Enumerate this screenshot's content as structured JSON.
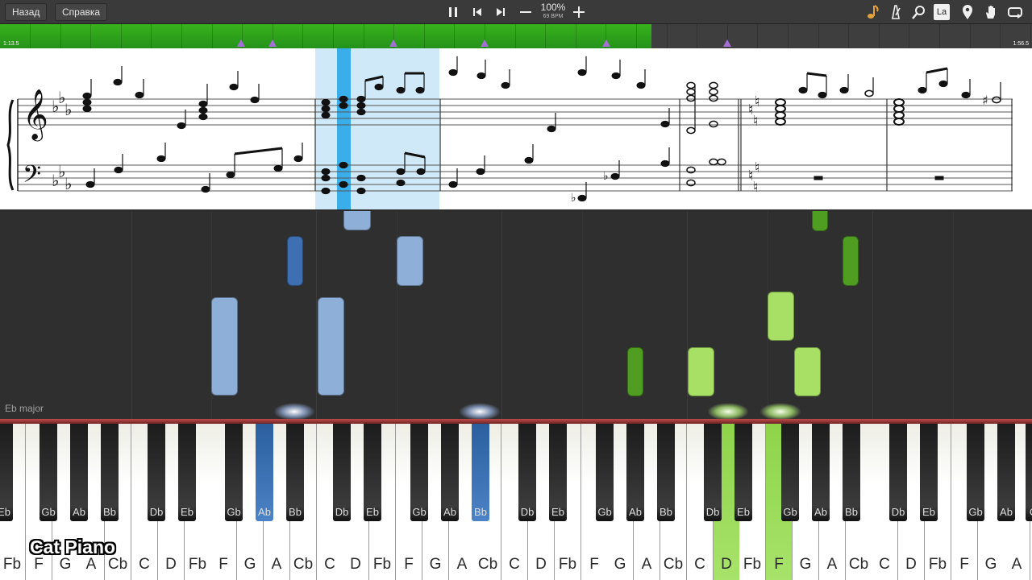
{
  "toolbar": {
    "back_label": "Назад",
    "help_label": "Справка",
    "speed_percent": "100%",
    "speed_bpm": "69 BPM",
    "icons": [
      "pause-icon",
      "skip-back-icon",
      "skip-forward-icon",
      "minus-icon",
      "plus-icon",
      "note-icon",
      "metronome-icon",
      "zoom-icon",
      "la-icon",
      "marker-icon",
      "hand-icon",
      "loop-icon"
    ],
    "la_label": "La"
  },
  "progress": {
    "current_time": "1:13.5",
    "total_time": "1:56.5",
    "fraction": 0.631,
    "accent_color": "#2aa81c",
    "marker_color": "#a46fd6"
  },
  "sheet": {
    "key_signature": "Eb major",
    "highlight_color": "#bfe3f7",
    "playhead_color": "#3aaeea"
  },
  "roll": {
    "key_label": "Eb major",
    "left_hand_color": "#3e6fb3",
    "right_hand_color": "#a8e065"
  },
  "keyboard": {
    "white_keys": [
      "Fb",
      "F",
      "G",
      "A",
      "Cb",
      "C",
      "D",
      "Fb",
      "F",
      "G",
      "A",
      "Cb",
      "C",
      "D",
      "Fb",
      "F",
      "G",
      "A",
      "Cb",
      "C",
      "D",
      "Fb",
      "F",
      "G",
      "A",
      "Cb",
      "C",
      "D",
      "Fb",
      "F",
      "G",
      "A",
      "Cb",
      "C",
      "D",
      "Fb",
      "F",
      "G",
      "A",
      "Ci"
    ],
    "black_keys": [
      "Eb",
      "Gb",
      "Ab",
      "Bb",
      "Db",
      "Eb",
      "Gb",
      "Ab",
      "Bb",
      "Db",
      "Eb",
      "Gb",
      "Ab",
      "Bb",
      "Db",
      "Eb",
      "Gb",
      "Ab",
      "Bb",
      "Db",
      "Eb",
      "Gb",
      "Ab",
      "Bb",
      "Db",
      "Eb",
      "Gb",
      "Ab",
      "Ci"
    ],
    "pressed_white": [
      "D",
      "F"
    ],
    "pressed_black": [
      "Bb",
      "Bb"
    ]
  },
  "watermark": "Cat Piano"
}
